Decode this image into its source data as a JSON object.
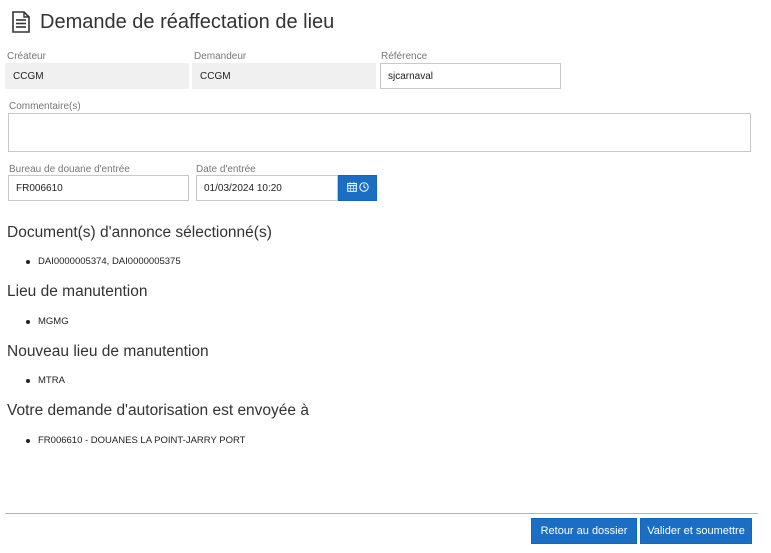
{
  "page": {
    "title": "Demande de réaffectation de lieu"
  },
  "form": {
    "createur": {
      "label": "Créateur",
      "value": "CCGM"
    },
    "demandeur": {
      "label": "Demandeur",
      "value": "CCGM"
    },
    "reference": {
      "label": "Référence",
      "value": "sjcarnaval"
    },
    "commentaires": {
      "label": "Commentaire(s)",
      "value": ""
    },
    "bureau_douane": {
      "label": "Bureau de douane d'entrée",
      "value": "FR006610"
    },
    "date_entree": {
      "label": "Date d'entrée",
      "value": "01/03/2024 10:20"
    }
  },
  "sections": [
    {
      "heading": "Document(s) d'annonce sélectionné(s)",
      "items": [
        "DAI0000005374, DAI0000005375"
      ]
    },
    {
      "heading": "Lieu de manutention",
      "items": [
        "MGMG"
      ]
    },
    {
      "heading": "Nouveau lieu de manutention",
      "items": [
        "MTRA"
      ]
    },
    {
      "heading": "Votre demande d'autorisation est envoyée à",
      "items": [
        "FR006610 - DOUANES LA POINT-JARRY PORT"
      ]
    }
  ],
  "actions": {
    "back_label": "Retour au dossier",
    "submit_label": "Valider et soumettre"
  },
  "icons": {
    "title_icon": "document-icon",
    "calendar_icon": "calendar-icon",
    "clock_icon": "clock-icon"
  },
  "colors": {
    "accent": "#1a6fc4",
    "readonly_bg": "#f0f0f0",
    "text": "#333333"
  }
}
